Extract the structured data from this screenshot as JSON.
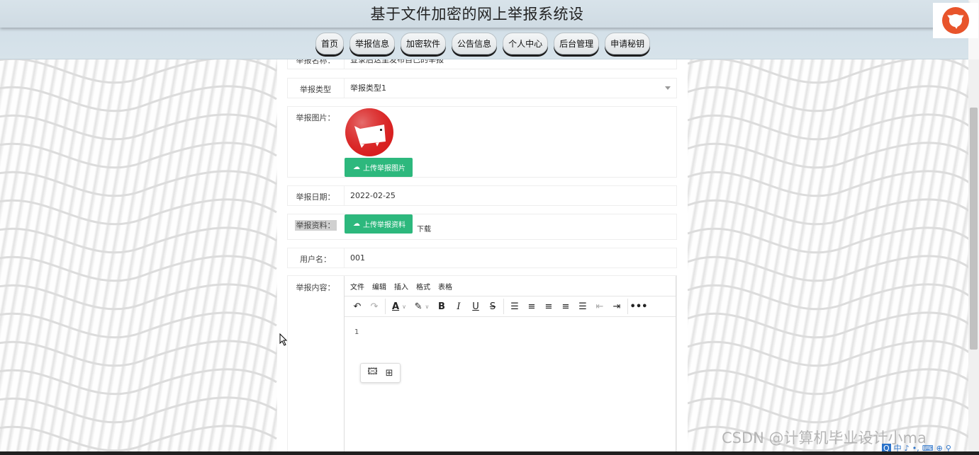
{
  "header": {
    "title": "基于文件加密的网上举报系统设",
    "nav": [
      "首页",
      "举报信息",
      "加密软件",
      "公告信息",
      "个人中心",
      "后台管理",
      "申请秘钥"
    ]
  },
  "form": {
    "report_name": {
      "label": "举报名称：",
      "value": "登录后这里发布自己的举报"
    },
    "report_type": {
      "label": "举报类型",
      "value": "举报类型1"
    },
    "report_image": {
      "label": "举报图片：",
      "upload_label": "上传举报图片"
    },
    "report_date": {
      "label": "举报日期：",
      "value": "2022-02-25"
    },
    "report_file": {
      "label": "举报资料：",
      "upload_label": "上传举报资料",
      "download_label": "下载"
    },
    "username": {
      "label": "用户名：",
      "value": "001"
    },
    "report_content": {
      "label": "举报内容：",
      "menu": [
        "文件",
        "编辑",
        "插入",
        "格式",
        "表格"
      ]
    }
  },
  "watermark": "CSDN @计算机毕业设计小ma",
  "tray": [
    "Q",
    "中",
    "♪",
    "•,",
    "⌨",
    "⊕",
    "⚲"
  ],
  "colors": {
    "accent_green": "#2db87d",
    "logo_red": "#d81e1e"
  }
}
